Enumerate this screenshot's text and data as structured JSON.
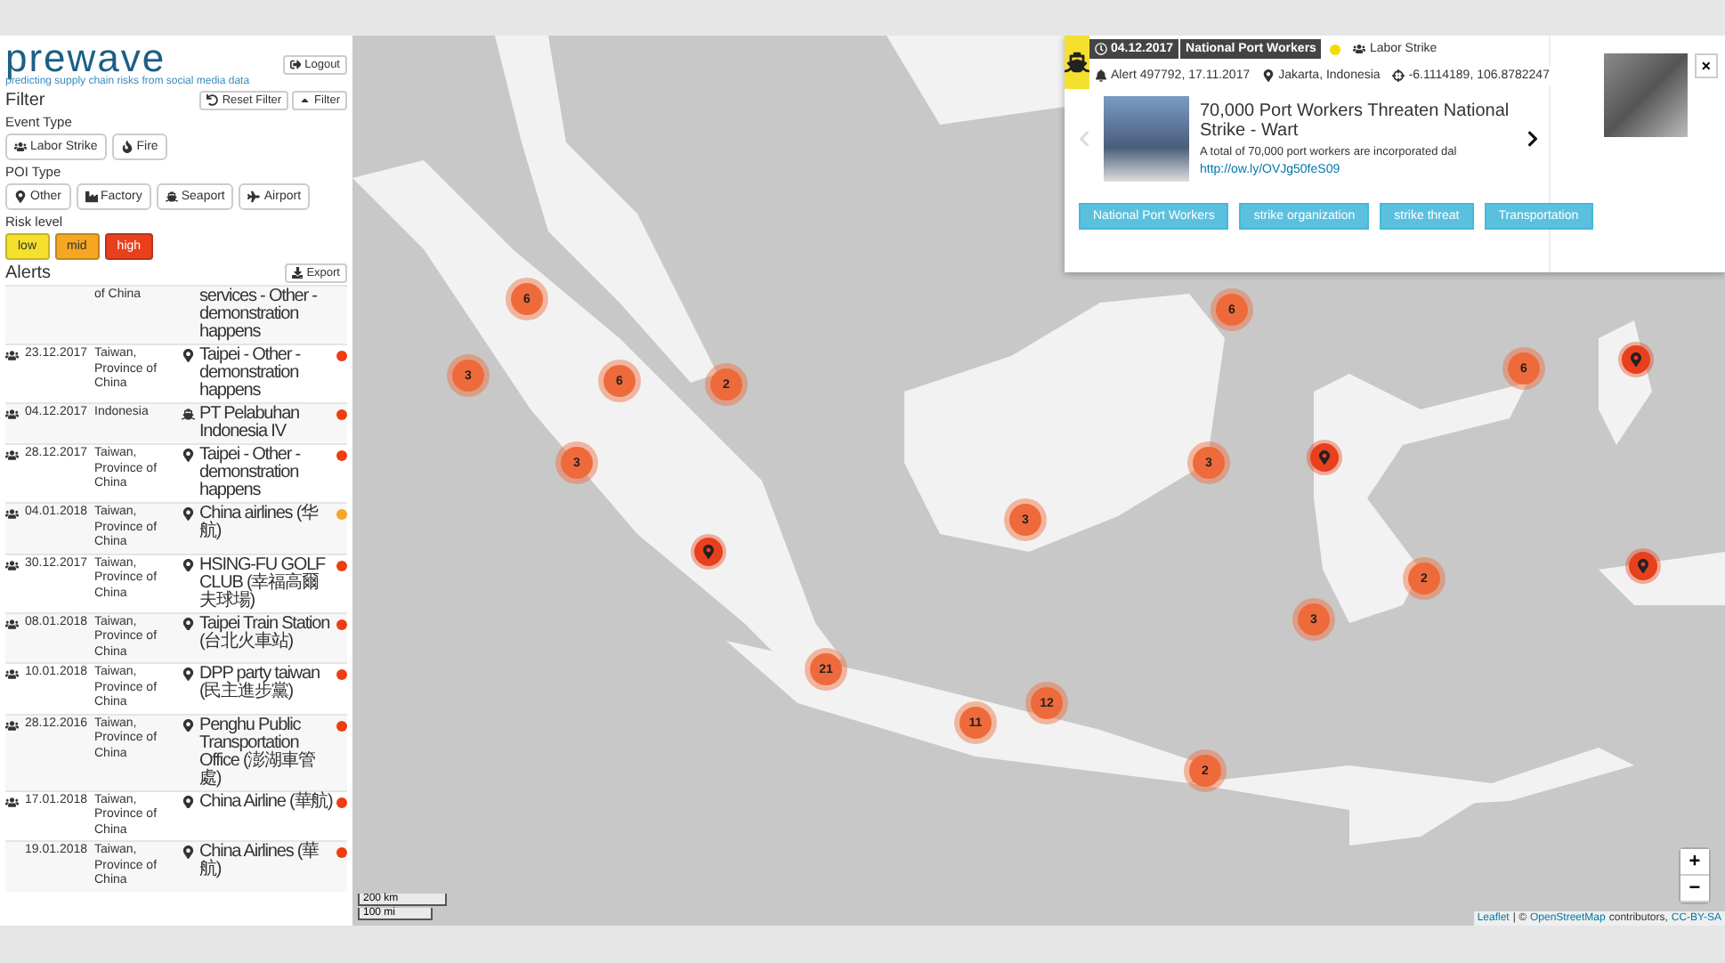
{
  "brand": {
    "name": "prewave",
    "tagline": "predicting supply chain risks from social media data"
  },
  "logout": "Logout",
  "filter": {
    "title": "Filter",
    "reset": "Reset Filter",
    "toggle": "Filter",
    "event_type": {
      "label": "Event Type",
      "options": [
        {
          "kind": "strike",
          "label": "Labor Strike"
        },
        {
          "kind": "fire",
          "label": "Fire"
        }
      ]
    },
    "poi_type": {
      "label": "POI Type",
      "options": [
        {
          "kind": "other",
          "label": "Other"
        },
        {
          "kind": "factory",
          "label": "Factory"
        },
        {
          "kind": "seaport",
          "label": "Seaport"
        },
        {
          "kind": "airport",
          "label": "Airport"
        }
      ]
    },
    "risk_level": {
      "label": "Risk level",
      "options": [
        {
          "label": "low",
          "color": "#f5e12d",
          "selected": true
        },
        {
          "label": "mid",
          "color": "#f5a623",
          "selected": true
        },
        {
          "label": "high",
          "color": "#e8401c",
          "selected": true
        }
      ]
    }
  },
  "alerts": {
    "title": "Alerts",
    "export": "Export",
    "rows": [
      {
        "country": "of China",
        "place": "services - Other - demonstration happens"
      },
      {
        "event": {
          "kind": "strike"
        },
        "date": "23.12.2017",
        "country": "Taiwan, Province of China",
        "poi": {
          "kind": "other"
        },
        "place": "Taipei - Other - demonstration happens",
        "color": "#f03c10"
      },
      {
        "event": {
          "kind": "strike"
        },
        "date": "04.12.2017",
        "country": "Indonesia",
        "poi": {
          "kind": "seaport"
        },
        "place": "PT Pelabuhan Indonesia IV",
        "color": "#f03c10"
      },
      {
        "event": {
          "kind": "strike"
        },
        "date": "28.12.2017",
        "country": "Taiwan, Province of China",
        "poi": {
          "kind": "other"
        },
        "place": "Taipei - Other - demonstration happens",
        "color": "#f03c10"
      },
      {
        "event": {
          "kind": "strike"
        },
        "date": "04.01.2018",
        "country": "Taiwan, Province of China",
        "poi": {
          "kind": "other"
        },
        "place": "China airlines (华航)",
        "color": "#f5a623"
      },
      {
        "event": {
          "kind": "strike"
        },
        "date": "30.12.2017",
        "country": "Taiwan, Province of China",
        "poi": {
          "kind": "other"
        },
        "place": "HSING-FU GOLF CLUB (幸福高爾夫球場)",
        "color": "#f03c10"
      },
      {
        "event": {
          "kind": "strike"
        },
        "date": "08.01.2018",
        "country": "Taiwan, Province of China",
        "poi": {
          "kind": "other"
        },
        "place": "Taipei Train Station (台北火車站)",
        "color": "#f03c10"
      },
      {
        "event": {
          "kind": "strike"
        },
        "date": "10.01.2018",
        "country": "Taiwan, Province of China",
        "poi": {
          "kind": "other"
        },
        "place": "DPP party taiwan (民主進步黨)",
        "color": "#f03c10"
      },
      {
        "event": {
          "kind": "strike"
        },
        "date": "28.12.2016",
        "country": "Taiwan, Province of China",
        "poi": {
          "kind": "other"
        },
        "place": "Penghu Public Transportation Office (澎湖車管處)",
        "color": "#f03c10"
      },
      {
        "event": {
          "kind": "strike"
        },
        "date": "17.01.2018",
        "country": "Taiwan, Province of China",
        "poi": {
          "kind": "other"
        },
        "place": "China Airline (華航)",
        "color": "#f03c10"
      },
      {
        "date": "19.01.2018",
        "country": "Taiwan, Province of China",
        "poi": {
          "kind": "other"
        },
        "place": "China Airlines (華航)",
        "color": "#f03c10"
      }
    ]
  },
  "map": {
    "markers": [
      {
        "kind": "cluster",
        "count": "6"
      },
      {
        "kind": "cluster",
        "count": "3"
      },
      {
        "kind": "cluster",
        "count": "6"
      },
      {
        "kind": "cluster",
        "count": "2"
      },
      {
        "kind": "cluster",
        "count": "3"
      },
      {
        "kind": "pin"
      },
      {
        "kind": "cluster",
        "count": "21"
      },
      {
        "kind": "cluster",
        "count": "11"
      },
      {
        "kind": "cluster",
        "count": "12"
      },
      {
        "kind": "cluster",
        "count": "3"
      },
      {
        "kind": "cluster",
        "count": "6"
      },
      {
        "kind": "cluster",
        "count": "3"
      },
      {
        "kind": "pin"
      },
      {
        "kind": "cluster",
        "count": "6"
      },
      {
        "kind": "pin"
      },
      {
        "kind": "cluster",
        "count": "2"
      },
      {
        "kind": "cluster",
        "count": "3"
      },
      {
        "kind": "pin"
      },
      {
        "kind": "cluster",
        "count": "2"
      }
    ],
    "scale": [
      "200 km",
      "100 mi"
    ],
    "zoom_in": "+",
    "zoom_out": "−",
    "attribution": {
      "leaflet": "Leaflet",
      "sep": "| ©",
      "osm": "OpenStreetMap",
      "contrib": "contributors,",
      "license": "CC-BY-SA"
    }
  },
  "popup": {
    "date": "04.12.2017",
    "source": "National Port Workers",
    "color": "#f5d90a",
    "event": "Labor Strike",
    "alert": "Alert 497792, 17.11.2017",
    "location": "Jakarta, Indonesia",
    "coords": "-6.1114189, 106.8782247",
    "article": {
      "title": "70,000 Port Workers Threaten National Strike - Wart",
      "snippet": "A total of 70,000 port workers are incorporated dal",
      "link": "http://ow.ly/OVJg50feS09"
    },
    "tags": [
      "National Port Workers",
      "strike organization",
      "strike threat",
      "Transportation"
    ],
    "close": "×"
  }
}
